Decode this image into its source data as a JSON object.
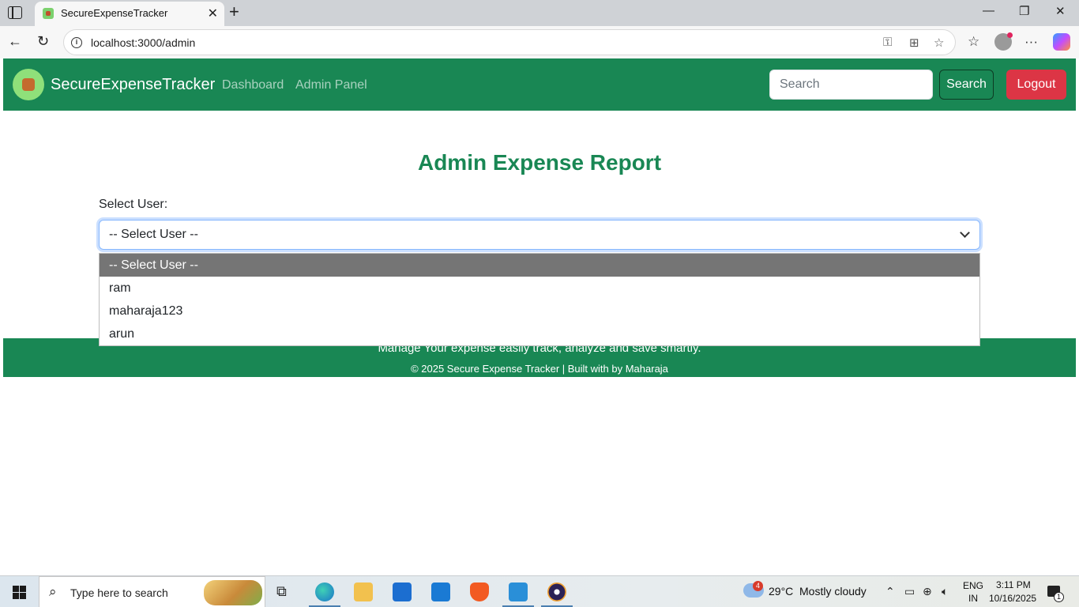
{
  "browser": {
    "tab_title": "SecureExpenseTracker",
    "url": "localhost:3000/admin"
  },
  "navbar": {
    "brand": "SecureExpenseTracker",
    "links": [
      "Dashboard",
      "Admin Panel"
    ],
    "search_placeholder": "Search",
    "search_button": "Search",
    "logout_button": "Logout"
  },
  "main": {
    "title": "Admin Expense Report",
    "select_label": "Select User:",
    "select_value": "-- Select User --",
    "options": [
      "-- Select User --",
      "ram",
      "maharaja123",
      "arun"
    ]
  },
  "footer": {
    "tagline": "Manage Your expense easily track, analyze and save smartly.",
    "copyright": "© 2025 Secure Expense Tracker | Built with by Maharaja"
  },
  "taskbar": {
    "search_text": "Type here to search",
    "weather_badge": "4",
    "temperature": "29°C",
    "weather": "Mostly cloudy",
    "lang_top": "ENG",
    "lang_bottom": "IN",
    "time": "3:11 PM",
    "date": "10/16/2025",
    "notification_count": "1"
  },
  "colors": {
    "brand_green": "#198754",
    "logout_red": "#dc3545",
    "selected_option": "#757575"
  }
}
